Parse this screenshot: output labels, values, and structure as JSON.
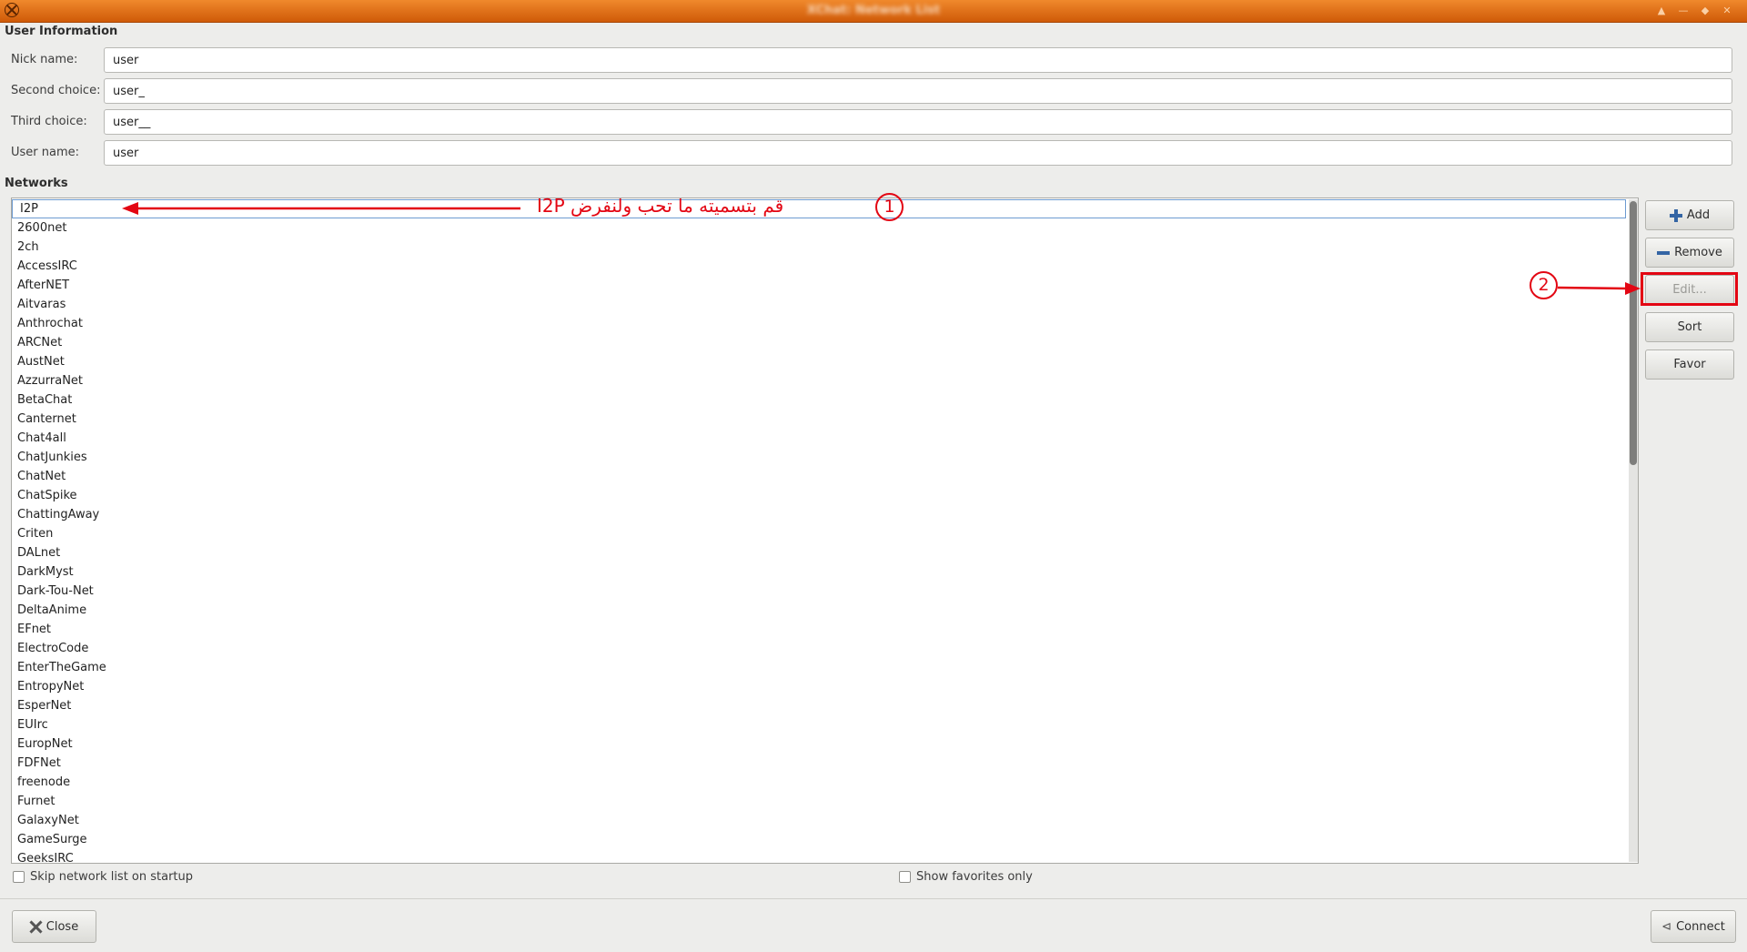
{
  "titlebar": {
    "title": "XChat: Network List",
    "buttons": [
      "▲",
      "—",
      "◆",
      "✕"
    ]
  },
  "user_info": {
    "section_title": "User Information",
    "fields": [
      {
        "label": "Nick name:",
        "value": "user"
      },
      {
        "label": "Second choice:",
        "value": "user_"
      },
      {
        "label": "Third choice:",
        "value": "user__"
      },
      {
        "label": "User name:",
        "value": "user"
      }
    ]
  },
  "networks": {
    "section_title": "Networks",
    "selected": "I2P",
    "items": [
      "I2P",
      "2600net",
      "2ch",
      "AccessIRC",
      "AfterNET",
      "Aitvaras",
      "Anthrochat",
      "ARCNet",
      "AustNet",
      "AzzurraNet",
      "BetaChat",
      "Canternet",
      "Chat4all",
      "ChatJunkies",
      "ChatNet",
      "ChatSpike",
      "ChattingAway",
      "Criten",
      "DALnet",
      "DarkMyst",
      "Dark-Tou-Net",
      "DeltaAnime",
      "EFnet",
      "ElectroCode",
      "EnterTheGame",
      "EntropyNet",
      "EsperNet",
      "EUIrc",
      "EuropNet",
      "FDFNet",
      "freenode",
      "Furnet",
      "GalaxyNet",
      "GameSurge",
      "GeeksIRC"
    ]
  },
  "side_buttons": {
    "add": "Add",
    "remove": "Remove",
    "edit": "Edit...",
    "sort": "Sort",
    "favor": "Favor"
  },
  "options": {
    "skip_startup": {
      "label": "Skip network list on startup",
      "checked": false
    },
    "favorites_only": {
      "label": "Show favorites only",
      "checked": false
    }
  },
  "footer": {
    "close": "Close",
    "connect": "Connect"
  },
  "annotations": {
    "step1": {
      "number": "1",
      "text": "قم بتسميته ما تحب ولنفرض I2P"
    },
    "step2": {
      "number": "2"
    },
    "color": "#e30613"
  },
  "icons": {
    "app": "xchat-icon",
    "add": "plus-icon",
    "remove": "minus-icon",
    "close": "close-icon",
    "connect": "connect-icon"
  }
}
